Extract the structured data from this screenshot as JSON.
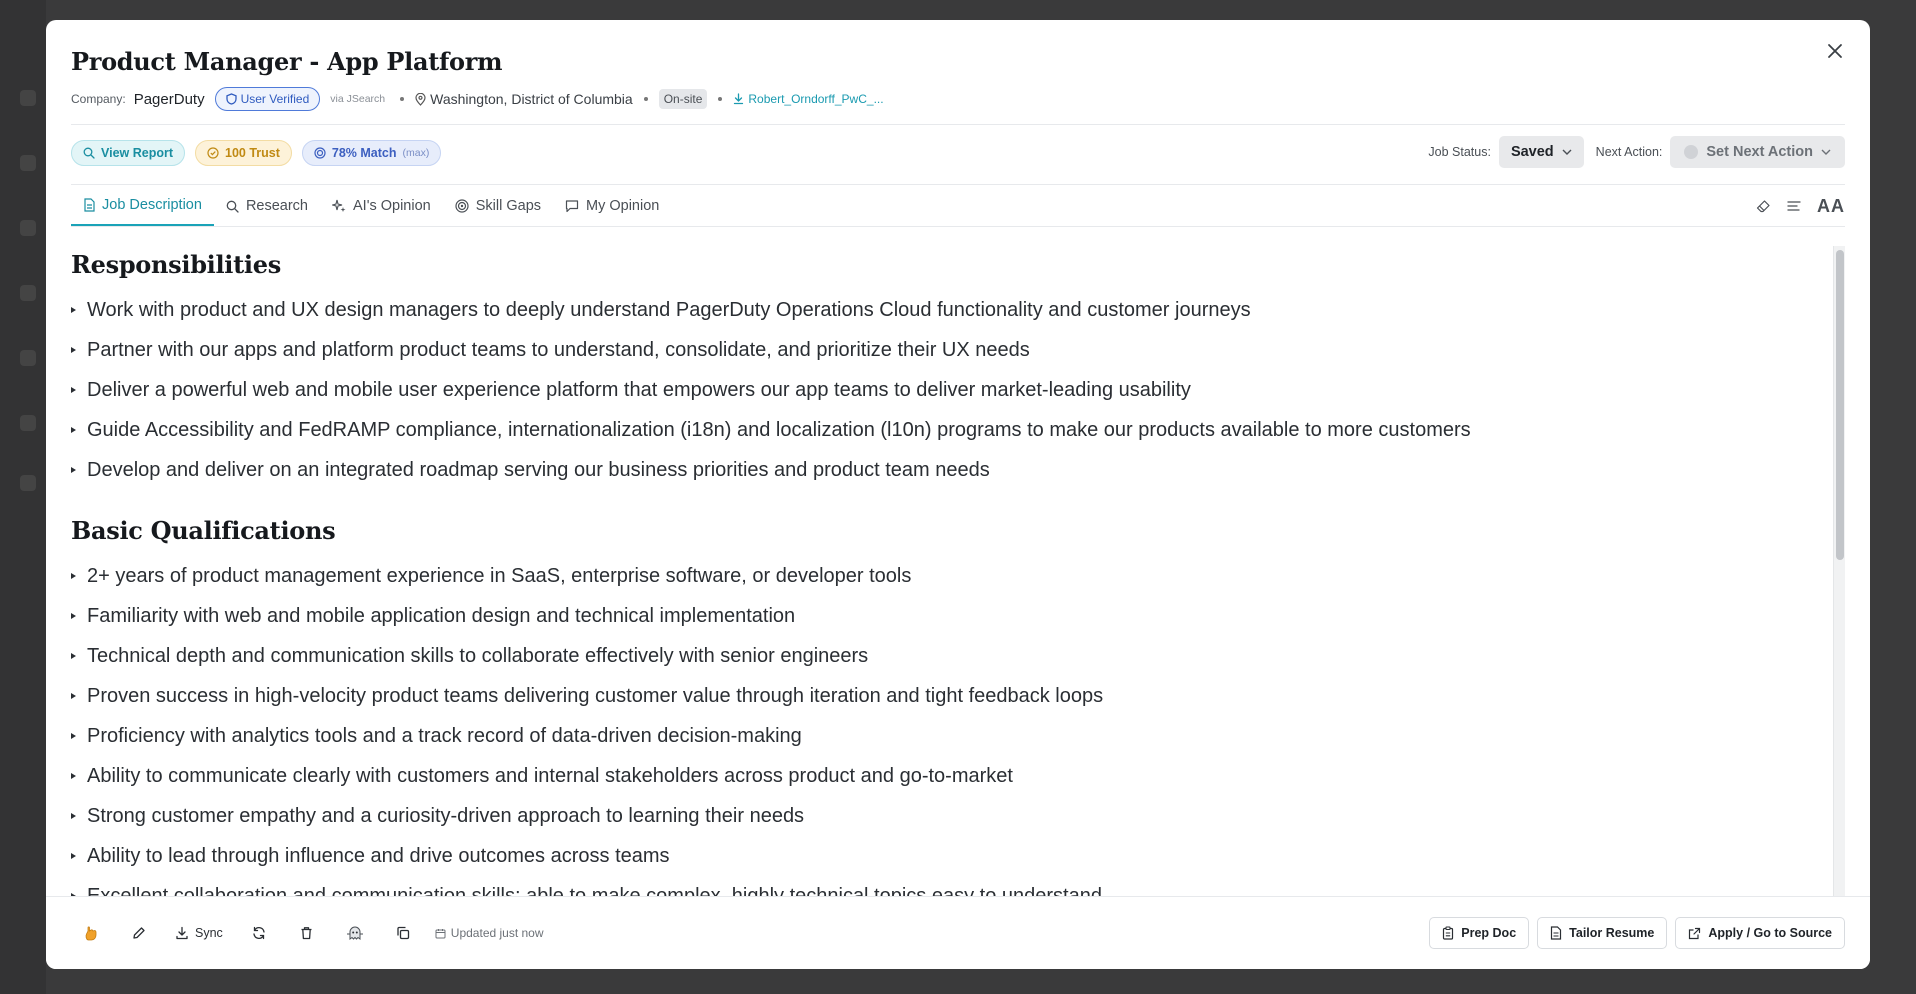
{
  "job": {
    "title": "Product Manager - App Platform",
    "company_label": "Company:",
    "company": "PagerDuty",
    "verified": "User Verified",
    "via": "via JSearch",
    "location": "Washington, District of Columbia",
    "work_mode": "On-site",
    "resume_file": "Robert_Orndorff_PwC_..."
  },
  "chips": {
    "report": "View Report",
    "trust": "100 Trust",
    "match": "78% Match",
    "match_sub": "(max)"
  },
  "status": {
    "job_status_label": "Job Status:",
    "job_status_value": "Saved",
    "next_action_label": "Next Action:",
    "next_action_value": "Set Next Action"
  },
  "tabs": [
    {
      "label": "Job Description",
      "icon": "document-icon"
    },
    {
      "label": "Research",
      "icon": "search-icon"
    },
    {
      "label": "AI's Opinion",
      "icon": "sparkles-icon"
    },
    {
      "label": "Skill Gaps",
      "icon": "target-icon"
    },
    {
      "label": "My Opinion",
      "icon": "chat-icon"
    }
  ],
  "tab_tools": {
    "font_size": "AA"
  },
  "content": {
    "sections": [
      {
        "heading": "Responsibilities",
        "items": [
          "Work with product and UX design managers to deeply understand PagerDuty Operations Cloud functionality and customer journeys",
          "Partner with our apps and platform product teams to understand, consolidate, and prioritize their UX needs",
          "Deliver a powerful web and mobile user experience platform that empowers our app teams to deliver market-leading usability",
          "Guide Accessibility and FedRAMP compliance, internationalization (i18n) and localization (l10n) programs to make our products available to more customers",
          "Develop and deliver on an integrated roadmap serving our business priorities and product team needs"
        ]
      },
      {
        "heading": "Basic Qualifications",
        "items": [
          "2+ years of product management experience in SaaS, enterprise software, or developer tools",
          "Familiarity with web and mobile application design and technical implementation",
          "Technical depth and communication skills to collaborate effectively with senior engineers",
          "Proven success in high-velocity product teams delivering customer value through iteration and tight feedback loops",
          "Proficiency with analytics tools and a track record of data-driven decision-making",
          "Ability to communicate clearly with customers and internal stakeholders across product and go-to-market",
          "Strong customer empathy and a curiosity-driven approach to learning their needs",
          "Ability to lead through influence and drive outcomes across teams",
          "Excellent collaboration and communication skills; able to make complex, highly technical topics easy to understand"
        ]
      }
    ]
  },
  "footer": {
    "sync": "Sync",
    "updated": "Updated just now",
    "prep_doc": "Prep Doc",
    "tailor_resume": "Tailor Resume",
    "apply": "Apply / Go to Source"
  },
  "colors": {
    "accent": "#1aa3b8",
    "overlay": "#2d2d2e"
  }
}
